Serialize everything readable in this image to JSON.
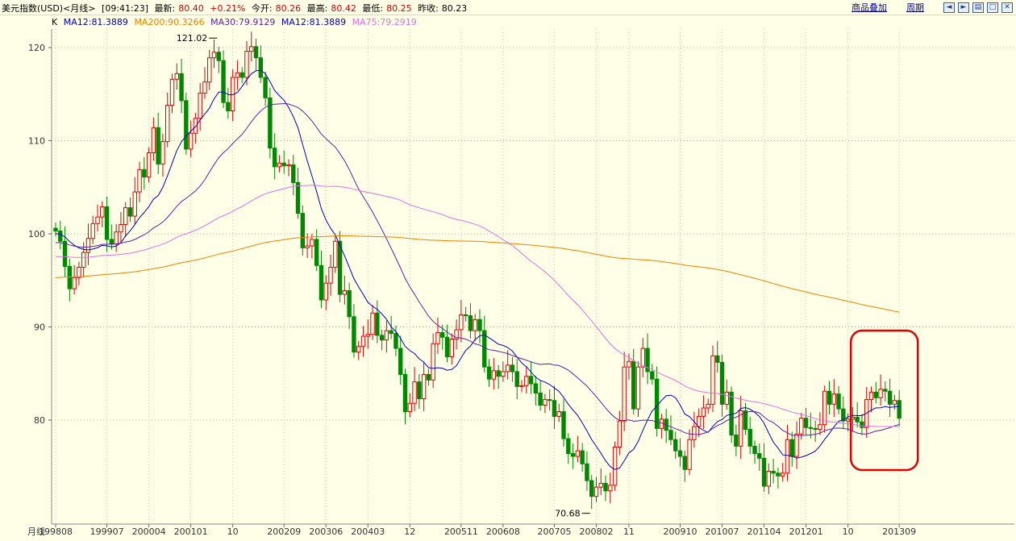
{
  "topbar": {
    "title": "美元指数(USD)<月线>",
    "time": "[09:41:23]",
    "latest_label": "最新:",
    "latest": "80.40",
    "change": "+0.21%",
    "open_label": "今开:",
    "open": "80.26",
    "high_label": "最高:",
    "high": "80.42",
    "low_label": "最低:",
    "low": "80.25",
    "prev_label": "昨收:",
    "prev": "80.23",
    "overlay_link": "商品叠加",
    "period_link": "周期"
  },
  "legend": {
    "k": "K",
    "ma12a": "MA12:81.3889",
    "ma200": "MA200:90.3266",
    "ma30": "MA30:79.9129",
    "ma12b": "MA12:81.3889",
    "ma75": "MA75:79.2919"
  },
  "colors": {
    "background": "#ffffe8",
    "up": "#e00000",
    "down": "#008800",
    "ma12": "#0000c0",
    "ma30": "#6020a0",
    "ma75": "#e070e0",
    "ma200": "#f08000",
    "highlight_box": "#e00000"
  },
  "chart_data": {
    "type": "candlestick",
    "x_axis_label": "月线",
    "x_ticks": [
      "199808",
      "199907",
      "200004",
      "200101",
      "10",
      "200209",
      "200306",
      "200403",
      "12",
      "200511",
      "200608",
      "200705",
      "200802",
      "11",
      "200910",
      "201007",
      "201104",
      "201201",
      "10",
      "201309"
    ],
    "y_ticks": [
      80,
      90,
      100,
      110,
      120
    ],
    "ylim": [
      70,
      122
    ],
    "annotations": [
      {
        "label": "121.02",
        "value": 121.02,
        "date": "2001-07"
      },
      {
        "label": "70.68",
        "value": 70.68,
        "date": "2008-03"
      }
    ],
    "highlight": {
      "from": "2012-12",
      "to": "2013-09"
    },
    "series_close": [
      {
        "year": 1998,
        "months": [
          100.3,
          99.2,
          96.5,
          94.1,
          95.3
        ]
      },
      {
        "year": 1999,
        "months": [
          96.4,
          98.0,
          99.5,
          101.1,
          101.8,
          102.9,
          99.4,
          98.9,
          100.2,
          101.0,
          102.8,
          101.9
        ]
      },
      {
        "year": 2000,
        "months": [
          104.5,
          106.9,
          106.1,
          108.7,
          111.4,
          107.5,
          109.9,
          113.8,
          116.6,
          117.2,
          114.3,
          109.1
        ]
      },
      {
        "year": 2001,
        "months": [
          110.8,
          112.4,
          115.1,
          116.3,
          118.9,
          119.5,
          118.6,
          114.1,
          113.2,
          116.8,
          117.3,
          116.8
        ]
      },
      {
        "year": 2002,
        "months": [
          119.6,
          120.1,
          118.9,
          116.8,
          114.6,
          109.2,
          107.2,
          107.6,
          107.3,
          107.4,
          105.5,
          102.2
        ]
      },
      {
        "year": 2003,
        "months": [
          98.5,
          98.7,
          99.4,
          96.6,
          92.9,
          94.7,
          96.4,
          99.2,
          93.5,
          93.9,
          91.1,
          87.3
        ]
      },
      {
        "year": 2004,
        "months": [
          87.9,
          89.0,
          89.2,
          91.5,
          89.1,
          88.6,
          89.6,
          89.3,
          87.7,
          84.9,
          80.9,
          81.8
        ]
      },
      {
        "year": 2005,
        "months": [
          84.1,
          82.3,
          84.9,
          84.3,
          88.2,
          89.4,
          88.9,
          86.8,
          88.7,
          89.7,
          91.3,
          91.2
        ]
      },
      {
        "year": 2006,
        "months": [
          89.6,
          90.8,
          89.6,
          85.7,
          84.4,
          85.3,
          84.7,
          85.2,
          85.9,
          85.2,
          83.6,
          83.7
        ]
      },
      {
        "year": 2007,
        "months": [
          84.7,
          83.9,
          82.9,
          81.6,
          82.2,
          82.1,
          80.4,
          80.9,
          78.0,
          76.4,
          76.1,
          76.7
        ]
      },
      {
        "year": 2008,
        "months": [
          75.3,
          73.5,
          71.8,
          72.8,
          73.2,
          72.4,
          73.0,
          77.1,
          79.9,
          85.7,
          86.3,
          81.2
        ]
      },
      {
        "year": 2009,
        "months": [
          85.7,
          87.7,
          85.2,
          84.4,
          79.1,
          80.1,
          78.9,
          77.9,
          76.7,
          76.1,
          74.7,
          77.9
        ]
      },
      {
        "year": 2010,
        "months": [
          79.3,
          80.4,
          81.3,
          81.7,
          86.9,
          86.2,
          81.7,
          83.0,
          78.4,
          77.2,
          81.0,
          79.0
        ]
      },
      {
        "year": 2011,
        "months": [
          77.2,
          76.4,
          75.9,
          72.9,
          74.5,
          74.3,
          74.0,
          74.3,
          77.9,
          76.1,
          78.5,
          80.2
        ]
      },
      {
        "year": 2012,
        "months": [
          79.2,
          79.1,
          79.0,
          79.5,
          83.1,
          81.7,
          82.8,
          81.2,
          79.9,
          80.1,
          80.3,
          79.8
        ]
      },
      {
        "year": 2013,
        "months": [
          79.2,
          82.2,
          83.0,
          82.4,
          83.3,
          83.1,
          81.7,
          82.1,
          80.2
        ]
      }
    ]
  }
}
